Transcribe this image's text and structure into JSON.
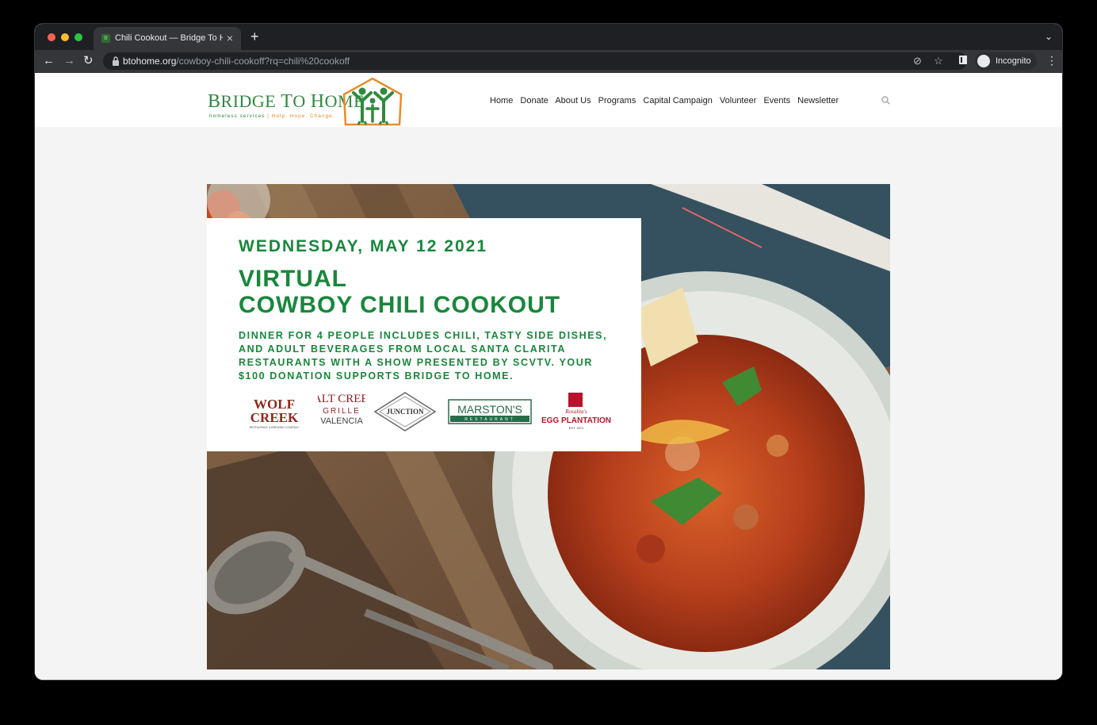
{
  "browser": {
    "tab_title": "Chili Cookout — Bridge To Home",
    "tab_favicon": "B",
    "url_host": "btohome.org",
    "url_path": "/cowboy-chili-cookoff?rq=chili%20cookoff",
    "incognito_label": "Incognito"
  },
  "site": {
    "logo_text_first": "B",
    "logo_text_rest1": "RIDGE ",
    "logo_text_to": "T",
    "logo_text_o": "O ",
    "logo_text_h": "H",
    "logo_text_ome": "OME",
    "logo_tagline_a": "homeless services",
    "logo_tagline_b": "| Help. Hope. Change.",
    "nav": [
      "Home",
      "Donate",
      "About Us",
      "Programs",
      "Capital Campaign",
      "Volunteer",
      "Events",
      "Newsletter"
    ]
  },
  "event": {
    "date": "WEDNESDAY, MAY 12 2021",
    "title_line1": "VIRTUAL",
    "title_line2": "COWBOY CHILI COOKOUT",
    "description": "Dinner for 4 people includes chili, tasty side dishes, and adult beverages from local Santa Clarita restaurants with a show presented by SCVTV. Your $100 donation supports Bridge To Home."
  },
  "sponsors": {
    "wolf_creek_1": "WOLF",
    "wolf_creek_2": "CREEK",
    "wolf_creek_sub": "RESTAURANT & BREWING COMPANY",
    "salt_creek_1": "SALT CREEK",
    "salt_creek_2": "GRILLE",
    "salt_creek_3": "VALENCIA",
    "junction": "JUNCTION",
    "marstons_1": "MARSTON'S",
    "marstons_2": "RESTAURANT",
    "egg_1": "Rosalita's",
    "egg_2": "EGG PLANTATION",
    "egg_3": "EST. 1971"
  },
  "colors": {
    "brand_green": "#18873c",
    "brand_orange": "#e98b2a"
  }
}
